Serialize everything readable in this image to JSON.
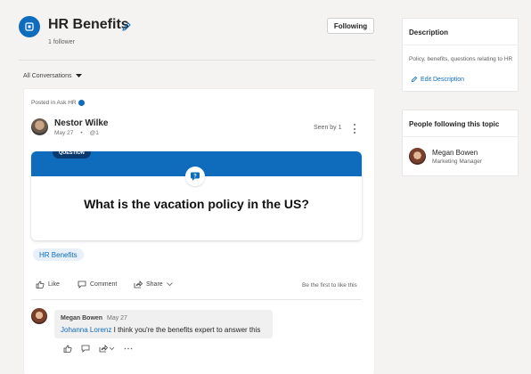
{
  "topic": {
    "title": "HR Benefits",
    "followers": "1 follower",
    "follow_button": "Following",
    "filter_label": "All Conversations"
  },
  "post": {
    "posted_in": "Posted in Ask HR",
    "author": "Nestor Wilke",
    "date": "May 27",
    "mentions": "@1",
    "seen": "Seen by 1",
    "badge": "QUESTION",
    "question": "What is the vacation policy in the US?",
    "tag": "HR Benefits",
    "actions": {
      "like": "Like",
      "comment": "Comment",
      "share": "Share"
    },
    "like_prompt": "Be the first to like this"
  },
  "reply": {
    "author": "Megan Bowen",
    "date": "May 27",
    "mention": "Johanna Lorenz",
    "text": "I think you're the benefits expert to answer this"
  },
  "sidebar": {
    "description_title": "Description",
    "description_text": "Policy, benefits, questions relating to HR",
    "edit_description": "Edit Description",
    "followers_title": "People following this topic",
    "follower": {
      "name": "Megan Bowen",
      "role": "Marketing Manager"
    }
  },
  "colors": {
    "accent": "#0f6cbd",
    "badge": "#0b3a6e",
    "background": "#f4f3f2"
  }
}
